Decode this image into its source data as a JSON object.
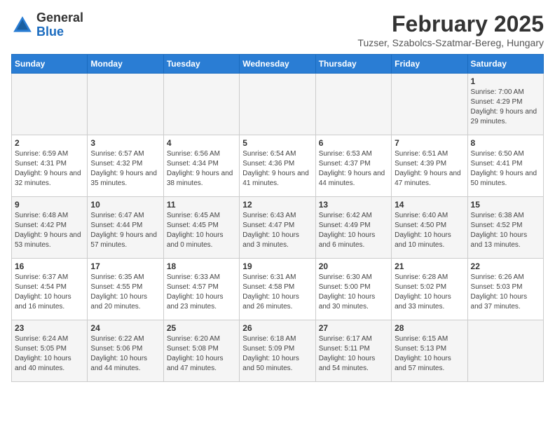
{
  "header": {
    "logo_general": "General",
    "logo_blue": "Blue",
    "month_title": "February 2025",
    "subtitle": "Tuzser, Szabolcs-Szatmar-Bereg, Hungary"
  },
  "weekdays": [
    "Sunday",
    "Monday",
    "Tuesday",
    "Wednesday",
    "Thursday",
    "Friday",
    "Saturday"
  ],
  "weeks": [
    [
      {
        "day": "",
        "info": ""
      },
      {
        "day": "",
        "info": ""
      },
      {
        "day": "",
        "info": ""
      },
      {
        "day": "",
        "info": ""
      },
      {
        "day": "",
        "info": ""
      },
      {
        "day": "",
        "info": ""
      },
      {
        "day": "1",
        "info": "Sunrise: 7:00 AM\nSunset: 4:29 PM\nDaylight: 9 hours and 29 minutes."
      }
    ],
    [
      {
        "day": "2",
        "info": "Sunrise: 6:59 AM\nSunset: 4:31 PM\nDaylight: 9 hours and 32 minutes."
      },
      {
        "day": "3",
        "info": "Sunrise: 6:57 AM\nSunset: 4:32 PM\nDaylight: 9 hours and 35 minutes."
      },
      {
        "day": "4",
        "info": "Sunrise: 6:56 AM\nSunset: 4:34 PM\nDaylight: 9 hours and 38 minutes."
      },
      {
        "day": "5",
        "info": "Sunrise: 6:54 AM\nSunset: 4:36 PM\nDaylight: 9 hours and 41 minutes."
      },
      {
        "day": "6",
        "info": "Sunrise: 6:53 AM\nSunset: 4:37 PM\nDaylight: 9 hours and 44 minutes."
      },
      {
        "day": "7",
        "info": "Sunrise: 6:51 AM\nSunset: 4:39 PM\nDaylight: 9 hours and 47 minutes."
      },
      {
        "day": "8",
        "info": "Sunrise: 6:50 AM\nSunset: 4:41 PM\nDaylight: 9 hours and 50 minutes."
      }
    ],
    [
      {
        "day": "9",
        "info": "Sunrise: 6:48 AM\nSunset: 4:42 PM\nDaylight: 9 hours and 53 minutes."
      },
      {
        "day": "10",
        "info": "Sunrise: 6:47 AM\nSunset: 4:44 PM\nDaylight: 9 hours and 57 minutes."
      },
      {
        "day": "11",
        "info": "Sunrise: 6:45 AM\nSunset: 4:45 PM\nDaylight: 10 hours and 0 minutes."
      },
      {
        "day": "12",
        "info": "Sunrise: 6:43 AM\nSunset: 4:47 PM\nDaylight: 10 hours and 3 minutes."
      },
      {
        "day": "13",
        "info": "Sunrise: 6:42 AM\nSunset: 4:49 PM\nDaylight: 10 hours and 6 minutes."
      },
      {
        "day": "14",
        "info": "Sunrise: 6:40 AM\nSunset: 4:50 PM\nDaylight: 10 hours and 10 minutes."
      },
      {
        "day": "15",
        "info": "Sunrise: 6:38 AM\nSunset: 4:52 PM\nDaylight: 10 hours and 13 minutes."
      }
    ],
    [
      {
        "day": "16",
        "info": "Sunrise: 6:37 AM\nSunset: 4:54 PM\nDaylight: 10 hours and 16 minutes."
      },
      {
        "day": "17",
        "info": "Sunrise: 6:35 AM\nSunset: 4:55 PM\nDaylight: 10 hours and 20 minutes."
      },
      {
        "day": "18",
        "info": "Sunrise: 6:33 AM\nSunset: 4:57 PM\nDaylight: 10 hours and 23 minutes."
      },
      {
        "day": "19",
        "info": "Sunrise: 6:31 AM\nSunset: 4:58 PM\nDaylight: 10 hours and 26 minutes."
      },
      {
        "day": "20",
        "info": "Sunrise: 6:30 AM\nSunset: 5:00 PM\nDaylight: 10 hours and 30 minutes."
      },
      {
        "day": "21",
        "info": "Sunrise: 6:28 AM\nSunset: 5:02 PM\nDaylight: 10 hours and 33 minutes."
      },
      {
        "day": "22",
        "info": "Sunrise: 6:26 AM\nSunset: 5:03 PM\nDaylight: 10 hours and 37 minutes."
      }
    ],
    [
      {
        "day": "23",
        "info": "Sunrise: 6:24 AM\nSunset: 5:05 PM\nDaylight: 10 hours and 40 minutes."
      },
      {
        "day": "24",
        "info": "Sunrise: 6:22 AM\nSunset: 5:06 PM\nDaylight: 10 hours and 44 minutes."
      },
      {
        "day": "25",
        "info": "Sunrise: 6:20 AM\nSunset: 5:08 PM\nDaylight: 10 hours and 47 minutes."
      },
      {
        "day": "26",
        "info": "Sunrise: 6:18 AM\nSunset: 5:09 PM\nDaylight: 10 hours and 50 minutes."
      },
      {
        "day": "27",
        "info": "Sunrise: 6:17 AM\nSunset: 5:11 PM\nDaylight: 10 hours and 54 minutes."
      },
      {
        "day": "28",
        "info": "Sunrise: 6:15 AM\nSunset: 5:13 PM\nDaylight: 10 hours and 57 minutes."
      },
      {
        "day": "",
        "info": ""
      }
    ]
  ]
}
